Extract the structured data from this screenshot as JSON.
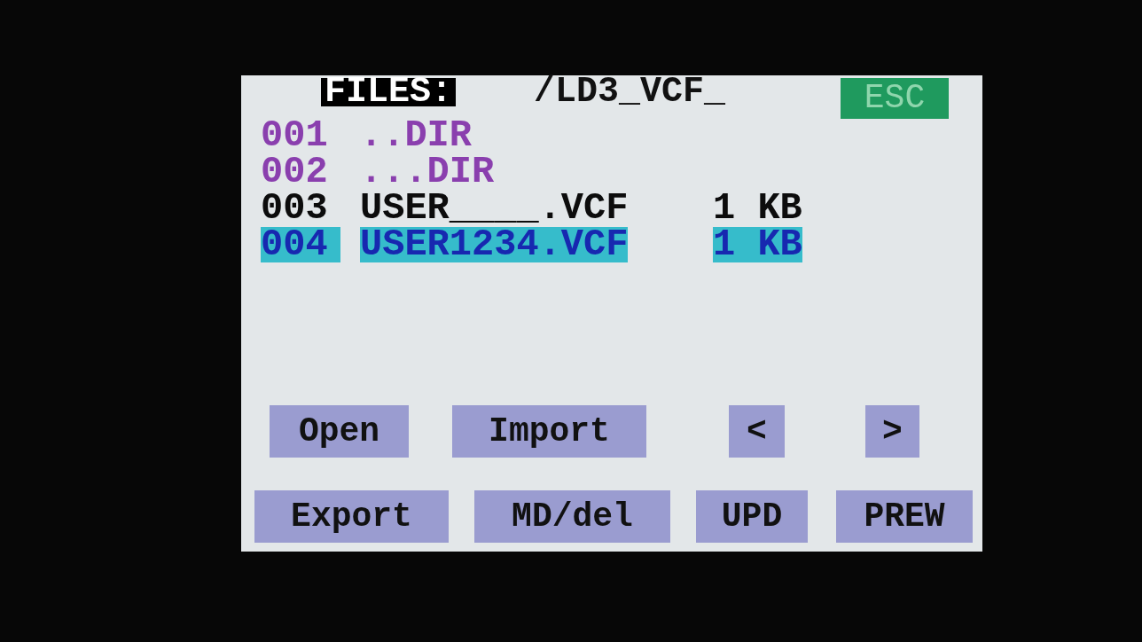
{
  "header": {
    "title": "FILES:",
    "path": "/LD3_VCF_",
    "esc": "ESC"
  },
  "files": [
    {
      "kind": "dir",
      "number": "001",
      "name": "..DIR",
      "selected": false
    },
    {
      "kind": "dir",
      "number": "002",
      "name": "...DIR",
      "selected": false
    },
    {
      "kind": "file",
      "number": "003",
      "name": "USER____.VCF",
      "size": "1 KB",
      "selected": false
    },
    {
      "kind": "file",
      "number": "004",
      "name": "USER1234.VCF",
      "size": "1 KB",
      "selected": true
    }
  ],
  "button_rows": [
    [
      "Open",
      "Import",
      "<",
      ">"
    ],
    [
      "Export",
      "MD/del",
      "UPD",
      "PREW"
    ]
  ]
}
